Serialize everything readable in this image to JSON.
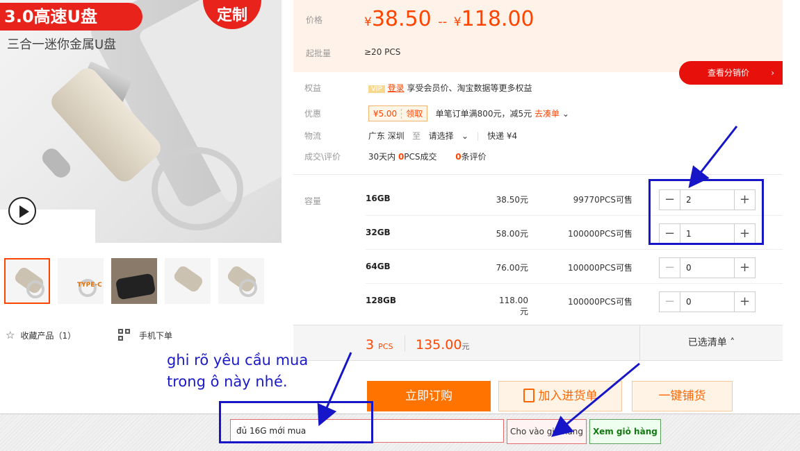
{
  "gallery": {
    "badge_title": "3.0高速U盘",
    "badge_custom": "定制",
    "subtitle": "三合一迷你金属U盘",
    "thumb_type_c_label": "TYPE-C",
    "favorite_label": "收藏产品（1）",
    "mobile_order_label": "手机下单",
    "icons": {
      "play": "play-icon",
      "star": "star-icon",
      "qr": "qr-code-icon"
    }
  },
  "price": {
    "label": "价格",
    "currency": "¥",
    "low": "38.50",
    "dash": "--",
    "high": "118.00",
    "moq_label": "起批量",
    "moq_value": "≥20 PCS",
    "distribution_button": "查看分销价",
    "distribution_arrow": "›"
  },
  "benefits": {
    "label": "权益",
    "vip_badge": "VIP",
    "login_link": "登录",
    "text": "享受会员价、淘宝数据等更多权益"
  },
  "discount": {
    "label": "优惠",
    "coupon_value": "¥5.00",
    "coupon_claim": "领取",
    "text": "单笔订单满800元，减5元",
    "link": "去凑单",
    "chevron": "⌄"
  },
  "logistics": {
    "label": "物流",
    "origin": "广东 深圳",
    "to": "至",
    "destination": "请选择",
    "chevron": "⌄",
    "shipping": "快递 ¥4"
  },
  "deals": {
    "label": "成交\\评价",
    "period": "30天内",
    "sold_count": "0",
    "sold_suffix": "PCS成交",
    "review_count": "0",
    "review_suffix": "条评价"
  },
  "sku": {
    "label": "容量",
    "rows": [
      {
        "name": "16GB",
        "price": "38.50元",
        "stock": "99770PCS可售",
        "qty": "2"
      },
      {
        "name": "32GB",
        "price": "58.00元",
        "stock": "100000PCS可售",
        "qty": "1"
      },
      {
        "name": "64GB",
        "price": "76.00元",
        "stock": "100000PCS可售",
        "qty": "0"
      },
      {
        "name": "128GB",
        "price": "118.00元",
        "stock": "100000PCS可售",
        "qty": "0"
      }
    ],
    "minus": "−",
    "plus": "+"
  },
  "summary": {
    "qty": "3",
    "qty_unit": "PCS",
    "total": "135.00",
    "total_unit": "元",
    "selected_list": "已选清单 ˄"
  },
  "actions": {
    "buy_now": "立即订购",
    "add_to_cart": "加入进货单",
    "one_click_store": "一键铺货"
  },
  "annotation": {
    "line1": "ghi rõ yêu cầu mua",
    "line2": "trong ô này nhé."
  },
  "bottom_bar": {
    "note_value": "đủ 16G mới mua",
    "add_cart_button": "Cho vào giỏ hàng",
    "view_cart_button": "Xem giỏ hàng"
  },
  "colors": {
    "accent": "#ff4400",
    "red": "#e8100a",
    "annotation_blue": "#1616c8",
    "price_bg": "#fff2e8"
  }
}
